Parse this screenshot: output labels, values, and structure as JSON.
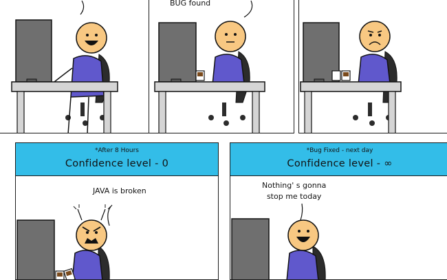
{
  "panels": [
    {
      "speech": ""
    },
    {
      "speech": "BUG found"
    },
    {
      "speech": ""
    },
    {
      "caption_note": "*After 8 Hours",
      "caption_title": "Confidence level - 0",
      "speech": "JAVA is broken"
    },
    {
      "caption_note": "*Bug Fixed - next day",
      "caption_title": "Confidence level - ∞",
      "speech_line1": "Nothing' s gonna",
      "speech_line2": "stop me today"
    }
  ],
  "colors": {
    "caption_bar": "#33bde8",
    "skin": "#f8c882",
    "shirt": "#6058cc",
    "monitor": "#6f6f6f",
    "desk": "#d5d5d5",
    "chair": "#2c2c2c",
    "coffee": "#7a4a1c"
  }
}
